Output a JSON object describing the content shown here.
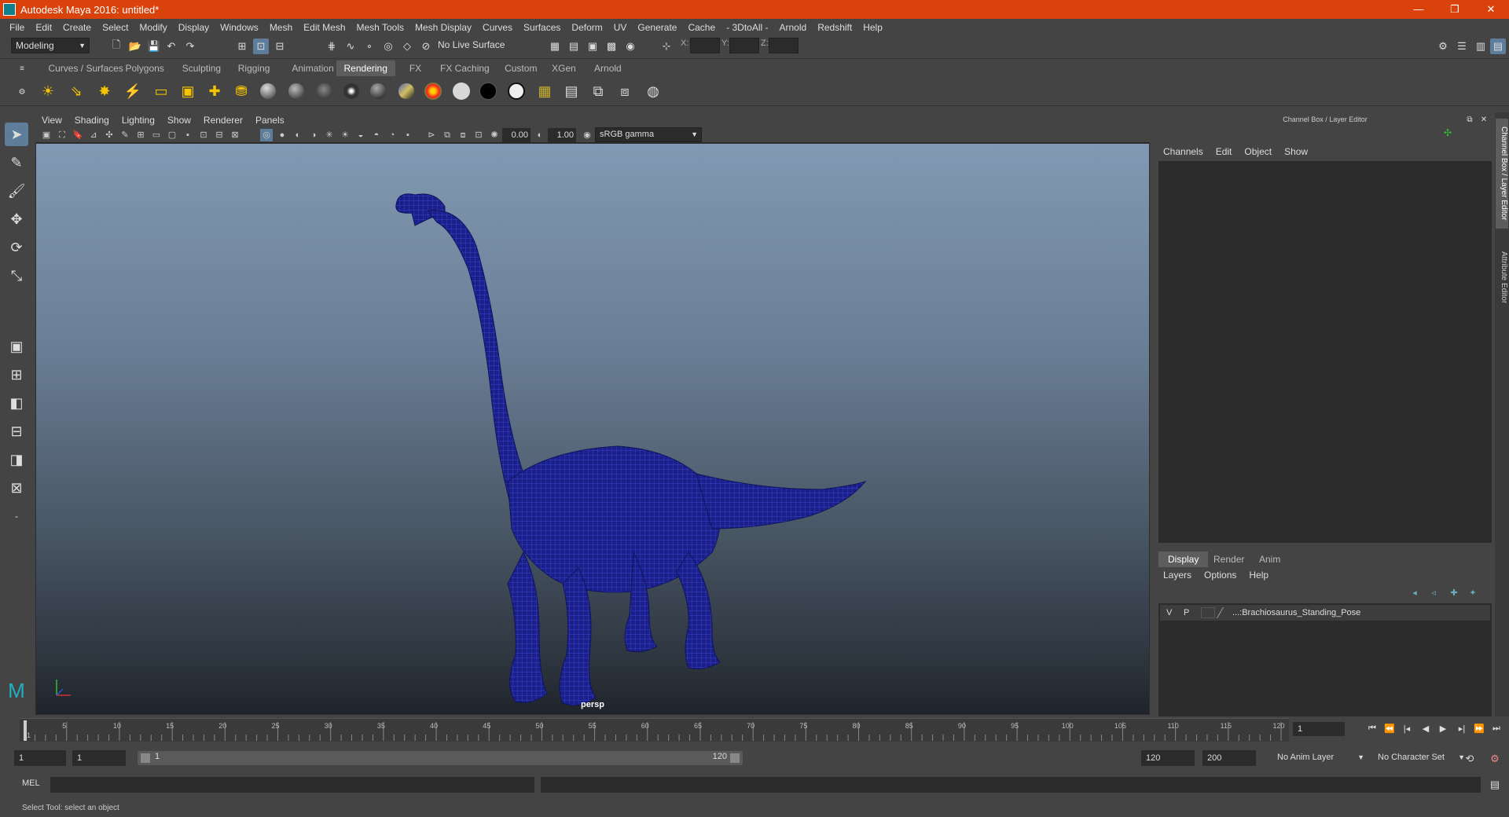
{
  "window": {
    "title": "Autodesk Maya 2016: untitled*",
    "controls": [
      "—",
      "❐",
      "✕"
    ]
  },
  "menubar": [
    "File",
    "Edit",
    "Create",
    "Select",
    "Modify",
    "Display",
    "Windows",
    "Mesh",
    "Edit Mesh",
    "Mesh Tools",
    "Mesh Display",
    "Curves",
    "Surfaces",
    "Deform",
    "UV",
    "Generate",
    "Cache",
    "- 3DtoAll -",
    "Arnold",
    "Redshift",
    "Help"
  ],
  "statusline": {
    "menuset": "Modeling",
    "live_surface": "No Live Surface",
    "x_label": "X:",
    "y_label": "Y:",
    "z_label": "Z:"
  },
  "shelf_tabs": [
    "Curves / Surfaces",
    "Polygons",
    "Sculpting",
    "Rigging",
    "Animation",
    "Rendering",
    "FX",
    "FX Caching",
    "Custom",
    "XGen",
    "Arnold"
  ],
  "shelf_selected": "Rendering",
  "panel_menu": [
    "View",
    "Shading",
    "Lighting",
    "Show",
    "Renderer",
    "Panels"
  ],
  "panel_toolbar": {
    "exposure": "0.00",
    "gamma": "1.00",
    "colorspace": "sRGB gamma"
  },
  "viewport": {
    "camera": "persp",
    "model": "Brachiosaurus wireframe"
  },
  "channel_box": {
    "title": "Channel Box / Layer Editor",
    "menu": [
      "Channels",
      "Edit",
      "Object",
      "Show"
    ]
  },
  "layer_editor": {
    "tabs": [
      "Display",
      "Render",
      "Anim"
    ],
    "selected_tab": "Display",
    "menu": [
      "Layers",
      "Options",
      "Help"
    ],
    "layer": {
      "v": "V",
      "p": "P",
      "name": "...:Brachiosaurus_Standing_Pose"
    }
  },
  "side_tabs": [
    "Channel Box / Layer Editor",
    "Attribute Editor"
  ],
  "timeline": {
    "ticks": [
      "1",
      "5",
      "10",
      "15",
      "20",
      "25",
      "30",
      "35",
      "40",
      "45",
      "50",
      "55",
      "60",
      "65",
      "70",
      "75",
      "80",
      "85",
      "90",
      "95",
      "100",
      "105",
      "110",
      "115",
      "120"
    ],
    "current_frame": "1"
  },
  "range": {
    "start": "1",
    "playback_start": "1",
    "range_start_label": "1",
    "range_end_label": "120",
    "playback_end": "120",
    "end": "200",
    "anim_layer": "No Anim Layer",
    "character_set": "No Character Set"
  },
  "command": {
    "label": "MEL"
  },
  "help_line": "Select Tool: select an object"
}
